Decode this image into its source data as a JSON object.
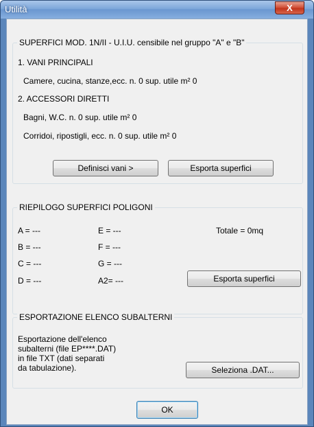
{
  "window": {
    "title": "Utilità",
    "close_glyph": "X"
  },
  "section1": {
    "legend": "SUPERFICI MOD. 1N/II - U.I.U. censibile nel gruppo \"A\" e \"B\"",
    "heading1": "1. VANI PRINCIPALI",
    "line1": "Camere, cucina, stanze,ecc. n. 0 sup. utile m² 0",
    "heading2": "2. ACCESSORI DIRETTI",
    "line2": "Bagni, W.C. n. 0 sup. utile m² 0",
    "line3": "Corridoi, ripostigli, ecc. n. 0 sup. utile m² 0",
    "button_define": "Definisci vani >",
    "button_export": "Esporta superfici"
  },
  "section2": {
    "legend": "RIEPILOGO SUPERFICI POLIGONI",
    "a": "A = ---",
    "b": "B = ---",
    "c": "C = ---",
    "d": "D = ---",
    "e": "E = ---",
    "f": "F = ---",
    "g": "G = ---",
    "a2": "A2= ---",
    "total": "Totale = 0mq",
    "button_export": "Esporta superfici"
  },
  "section3": {
    "legend": "ESPORTAZIONE ELENCO SUBALTERNI",
    "desc_lines": [
      "Esportazione dell'elenco",
      "subalterni (file EP****.DAT)",
      "in file TXT (dati separati",
      "da tabulazione)."
    ],
    "button_select": "Seleziona .DAT..."
  },
  "ok_button": "OK",
  "colors": {
    "title_bar": "#7ea7da",
    "close_button": "#c1351d",
    "dialog_bg": "#f0f0f0"
  }
}
